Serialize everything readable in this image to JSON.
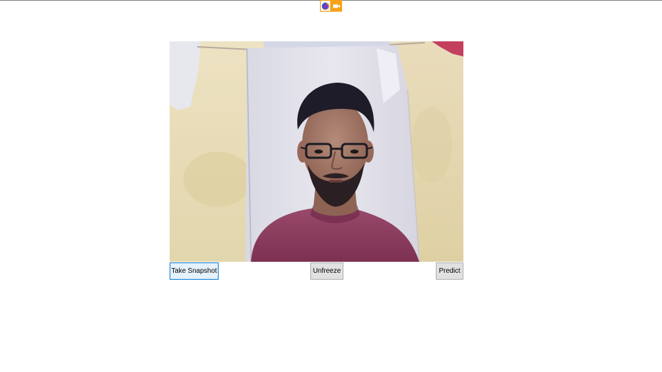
{
  "taskbar": {
    "icons": [
      "firefox-browser-icon",
      "camera-in-use-icon"
    ]
  },
  "webcam": {
    "icon": "webcam-frozen-snapshot"
  },
  "controls": {
    "take_snapshot_label": "Take Snapshot",
    "unfreeze_label": "Unfreeze",
    "predict_label": "Predict"
  },
  "colors": {
    "accent": "#0078d7",
    "button_bg": "#e1e1e1",
    "camera_indicator": "#f7a21b"
  }
}
